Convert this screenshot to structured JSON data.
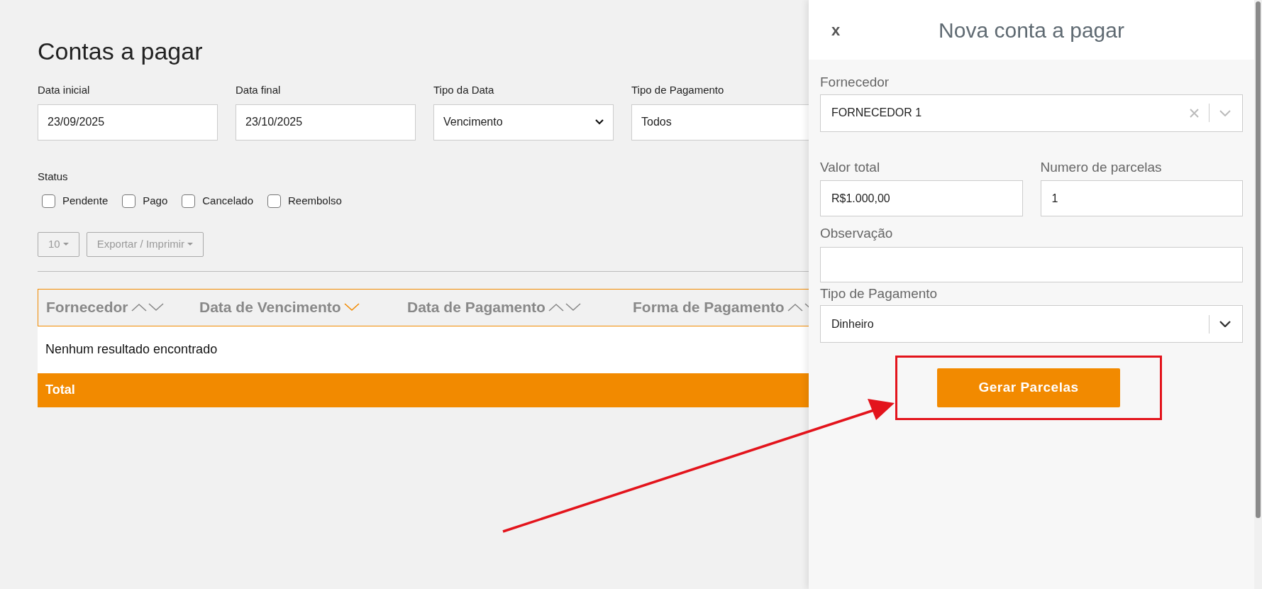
{
  "page": {
    "title": "Contas a pagar"
  },
  "filters": [
    {
      "label": "Data inicial",
      "value": "23/09/2025",
      "kind": "text"
    },
    {
      "label": "Data final",
      "value": "23/10/2025",
      "kind": "text"
    },
    {
      "label": "Tipo da Data",
      "value": "Vencimento",
      "kind": "select"
    },
    {
      "label": "Tipo de Pagamento",
      "value": "Todos",
      "kind": "text"
    }
  ],
  "status": {
    "label": "Status",
    "options": [
      {
        "label": "Pendente",
        "checked": false
      },
      {
        "label": "Pago",
        "checked": false
      },
      {
        "label": "Cancelado",
        "checked": false
      },
      {
        "label": "Reembolso",
        "checked": false
      }
    ]
  },
  "toolbar": {
    "page_size": "10",
    "export": "Exportar / Imprimir"
  },
  "table": {
    "columns": [
      {
        "label": "Fornecedor",
        "sorted": false
      },
      {
        "label": "Data de Vencimento",
        "sorted": true
      },
      {
        "label": "Data de Pagamento",
        "sorted": false
      },
      {
        "label": "Forma de Pagamento",
        "sorted": false
      }
    ],
    "empty_message": "Nenhum resultado encontrado",
    "total_label": "Total"
  },
  "drawer": {
    "close": "x",
    "title": "Nova conta a pagar",
    "supplier": {
      "label": "Fornecedor",
      "value": "FORNECEDOR 1"
    },
    "total_value": {
      "label": "Valor total",
      "value": "R$1.000,00"
    },
    "installments": {
      "label": "Numero de parcelas",
      "value": "1"
    },
    "note": {
      "label": "Observação"
    },
    "payment_type": {
      "label": "Tipo de Pagamento",
      "value": "Dinheiro"
    },
    "button": "Gerar Parcelas"
  }
}
